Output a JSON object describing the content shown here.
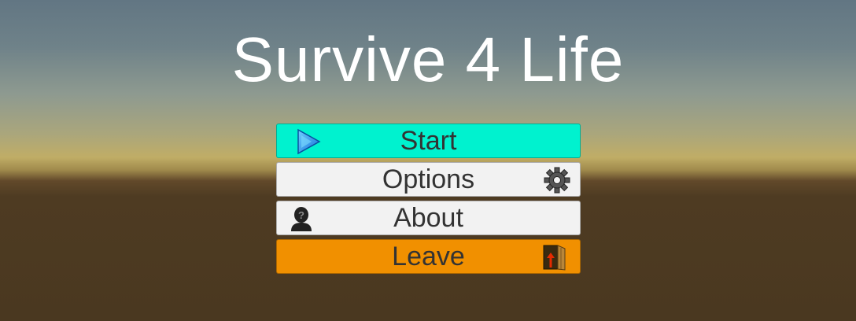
{
  "title": "Survive 4 Life",
  "menu": {
    "buttons": [
      {
        "label": "Start",
        "icon": "play-icon",
        "color": "#00f2cf"
      },
      {
        "label": "Options",
        "icon": "gear-icon",
        "color": "#f2f2f2"
      },
      {
        "label": "About",
        "icon": "person-question-icon",
        "color": "#f2f2f2"
      },
      {
        "label": "Leave",
        "icon": "exit-door-icon",
        "color": "#f19000"
      }
    ]
  },
  "colors": {
    "sky": "#627683",
    "horizon": "#c0ad66",
    "ground": "#4a3820",
    "title_text": "#ffffff"
  }
}
